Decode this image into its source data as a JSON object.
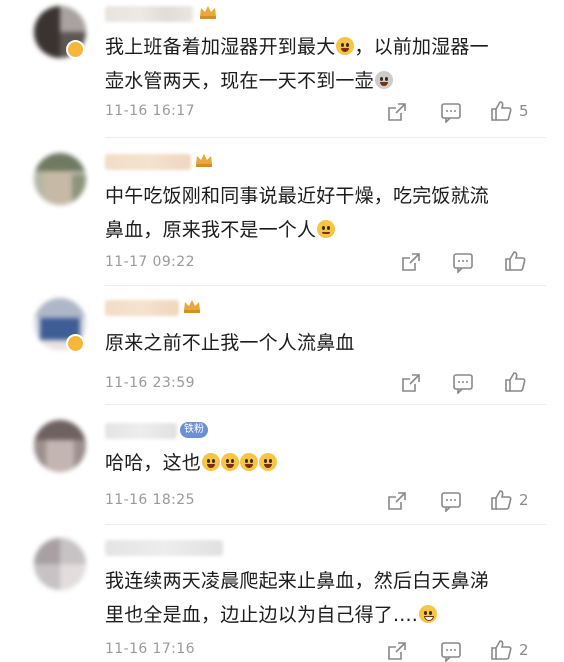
{
  "comments": [
    {
      "text": "我上班备着加湿器开到最大",
      "text2": "，以前加湿器一",
      "line2": "壶水管两天，现在一天不到一壶",
      "time": "11-16 16:17",
      "likes": "5",
      "badge": ""
    },
    {
      "text": "中午吃饭刚和同事说最近好干燥，吃完饭就流",
      "line2": "鼻血，原来我不是一个人",
      "time": "11-17 09:22",
      "likes": "",
      "badge": ""
    },
    {
      "text": "原来之前不止我一个人流鼻血",
      "time": "11-16 23:59",
      "likes": "",
      "badge": ""
    },
    {
      "text": "哈哈，这也",
      "time": "11-16 18:25",
      "likes": "2",
      "badge": "铁粉"
    },
    {
      "text": "我连续两天凌晨爬起来止鼻血，然后白天鼻涕",
      "line2": "里也全是血，边止边以为自己得了....",
      "time": "11-16 17:16",
      "likes": "2",
      "badge": ""
    }
  ],
  "icons": {
    "share": "share-icon",
    "comment": "comment-icon",
    "like": "thumbs-up-icon",
    "emoji": "emoji-icon",
    "crown": "crown-badge-icon"
  },
  "colors": {
    "meta": "#9a9a9a",
    "text": "#1c1c1c",
    "badge": "#6c8fd6",
    "crown": "#e8a93a"
  }
}
